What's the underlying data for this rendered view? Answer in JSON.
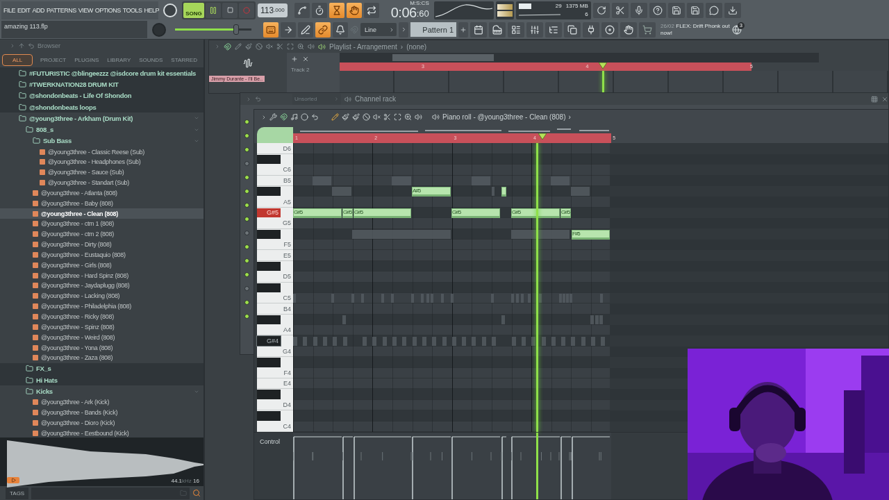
{
  "menu": [
    "FILE",
    "EDIT",
    "ADD",
    "PATTERNS",
    "VIEW",
    "OPTIONS",
    "TOOLS",
    "HELP"
  ],
  "transport": {
    "mode": {
      "label": "SONG",
      "selected": true
    },
    "playing": true,
    "tempo": "113",
    "tempo_fraction": ".000"
  },
  "toggles_top": [
    {
      "kind": "blend",
      "on": false
    },
    {
      "kind": "metronome",
      "on": false
    },
    {
      "kind": "countdown",
      "on": true
    },
    {
      "kind": "wait",
      "on": true
    },
    {
      "kind": "loop",
      "on": false
    }
  ],
  "time": {
    "main": "0:06",
    "centis": ":60",
    "unit": "M:S:CS"
  },
  "cpu": {
    "voices": "29",
    "memory": "1375 MB",
    "polyphony": "6"
  },
  "file_name": "amazing 113.flp",
  "master_volume": {
    "level": 0.8
  },
  "toggles_bottom": [
    {
      "kind": "keyboard",
      "on": true
    },
    {
      "kind": "step",
      "on": false
    },
    {
      "kind": "slide",
      "on": false
    },
    {
      "kind": "link",
      "on": true
    },
    {
      "kind": "bell",
      "on": false
    }
  ],
  "snap": "Line",
  "pattern": "Pattern 1",
  "news": {
    "date": "26/02",
    "text": "FLEX: Drift Phonk out now!",
    "badge": "3"
  },
  "browser": {
    "title": "Browser",
    "tabs": [
      {
        "label": "ALL",
        "selected": true
      },
      {
        "label": "PROJECT",
        "selected": false
      },
      {
        "label": "PLUGINS",
        "selected": false
      },
      {
        "label": "LIBRARY",
        "selected": false
      },
      {
        "label": "SOUNDS",
        "selected": false
      },
      {
        "label": "STARRED",
        "selected": false
      }
    ],
    "tree": [
      {
        "kind": "folder",
        "label": "#FUTURISTIC @blingeezzz @isdcore drum kit essentials",
        "expanded": false,
        "selected": false
      },
      {
        "kind": "folder",
        "label": "#TWERKNATION28 DRUM KIT",
        "expanded": false,
        "selected": false
      },
      {
        "kind": "folder",
        "label": "@shondonbeats - Life Of Shondon",
        "expanded": false,
        "selected": false
      },
      {
        "kind": "folder",
        "label": "@shondonbeats loops",
        "expanded": false,
        "selected": false
      },
      {
        "kind": "folder",
        "label": "@young3three - Arkham (Drum Kit)",
        "expanded": true,
        "selected": false,
        "children": [
          {
            "kind": "folder",
            "label": "808_s",
            "expanded": true,
            "selected": false,
            "children": [
              {
                "kind": "folder",
                "label": "Sub Bass",
                "expanded": true,
                "selected": false,
                "children": [
                  {
                    "kind": "file",
                    "label": "@young3three - Classic Reese (Sub)",
                    "selected": false
                  },
                  {
                    "kind": "file",
                    "label": "@young3three - Headphones (Sub)",
                    "selected": false
                  },
                  {
                    "kind": "file",
                    "label": "@young3three - Sauce (Sub)",
                    "selected": false
                  },
                  {
                    "kind": "file",
                    "label": "@young3three - Standart (Sub)",
                    "selected": false
                  }
                ]
              },
              {
                "kind": "file",
                "label": "@young3three - Atlanta (808)",
                "selected": false
              },
              {
                "kind": "file",
                "label": "@young3three - Baby (808)",
                "selected": false
              },
              {
                "kind": "file",
                "label": "@young3three - Clean (808)",
                "selected": true
              },
              {
                "kind": "file",
                "label": "@young3three - ctm 1 (808)",
                "selected": false
              },
              {
                "kind": "file",
                "label": "@young3three - ctm 2 (808)",
                "selected": false
              },
              {
                "kind": "file",
                "label": "@young3three - Dirty (808)",
                "selected": false
              },
              {
                "kind": "file",
                "label": "@young3three - Eustaquio (808)",
                "selected": false
              },
              {
                "kind": "file",
                "label": "@young3three - Girls (808)",
                "selected": false
              },
              {
                "kind": "file",
                "label": "@young3three - Hard Spinz (808)",
                "selected": false
              },
              {
                "kind": "file",
                "label": "@young3three - Jaydaplugg (808)",
                "selected": false
              },
              {
                "kind": "file",
                "label": "@young3three - Lacking (808)",
                "selected": false
              },
              {
                "kind": "file",
                "label": "@young3three - Philadelphia (808)",
                "selected": false
              },
              {
                "kind": "file",
                "label": "@young3three - Ricky (808)",
                "selected": false
              },
              {
                "kind": "file",
                "label": "@young3three - Spinz (808)",
                "selected": false
              },
              {
                "kind": "file",
                "label": "@young3three - Weird (808)",
                "selected": false
              },
              {
                "kind": "file",
                "label": "@young3three - Yona (808)",
                "selected": false
              },
              {
                "kind": "file",
                "label": "@young3three - Zaza (808)",
                "selected": false
              }
            ]
          },
          {
            "kind": "folder",
            "label": "FX_s",
            "expanded": false,
            "selected": false
          },
          {
            "kind": "folder",
            "label": "Hi Hats",
            "expanded": false,
            "selected": false
          },
          {
            "kind": "folder",
            "label": "Kicks",
            "expanded": true,
            "selected": false,
            "children": [
              {
                "kind": "file",
                "label": "@young3three - Ark (Kick)",
                "selected": false
              },
              {
                "kind": "file",
                "label": "@young3three - Bands (Kick)",
                "selected": false
              },
              {
                "kind": "file",
                "label": "@young3three - Dioro (Kick)",
                "selected": false
              },
              {
                "kind": "file",
                "label": "@young3three - Eestbound (Kick)",
                "selected": false
              }
            ]
          }
        ]
      }
    ],
    "sample_info": {
      "rate": "44.1",
      "unit": "kHz",
      "bits": "16"
    },
    "tags_button": "TAGS"
  },
  "playlist": {
    "title": "Playlist - Arrangement",
    "separator": "›",
    "target": "(none)",
    "track_clip": "Jimmy Durante - I'll Be..",
    "track_name": "Track 2",
    "ruler": [
      "3",
      "4",
      "5"
    ]
  },
  "channel_rack": {
    "filter": "Unsorted",
    "title": "Channel rack",
    "leds": [
      {
        "on": true
      },
      {
        "on": true
      },
      {
        "on": true
      },
      {
        "on": false
      },
      {
        "on": true
      },
      {
        "on": true
      },
      {
        "on": true
      },
      {
        "on": true
      },
      {
        "on": false
      },
      {
        "on": true
      },
      {
        "on": true
      },
      {
        "on": true
      },
      {
        "on": false
      },
      {
        "on": true
      },
      {
        "on": true
      }
    ]
  },
  "piano_roll": {
    "title": "Piano roll - @young3three - Clean (808)",
    "title_arrow": "›",
    "ruler": [
      "1",
      "2",
      "3",
      "4",
      "5"
    ],
    "keys": [
      {
        "label": "D6",
        "black": false,
        "playing": false,
        "highlighted": false
      },
      {
        "black": true,
        "playing": false,
        "highlighted": false
      },
      {
        "label": "C6",
        "black": false,
        "playing": false,
        "highlighted": false
      },
      {
        "label": "B5",
        "black": false,
        "playing": false,
        "highlighted": false
      },
      {
        "black": true,
        "playing": false,
        "highlighted": false
      },
      {
        "label": "A5",
        "black": false,
        "playing": false,
        "highlighted": false
      },
      {
        "label": "G#5",
        "black": true,
        "playing": true,
        "highlighted": false
      },
      {
        "label": "G5",
        "black": false,
        "playing": false,
        "highlighted": false
      },
      {
        "black": true,
        "playing": false,
        "highlighted": false
      },
      {
        "label": "F5",
        "black": false,
        "playing": false,
        "highlighted": false
      },
      {
        "label": "E5",
        "black": false,
        "playing": false,
        "highlighted": false
      },
      {
        "black": true,
        "playing": false,
        "highlighted": false
      },
      {
        "label": "D5",
        "black": false,
        "playing": false,
        "highlighted": false
      },
      {
        "black": true,
        "playing": false,
        "highlighted": false
      },
      {
        "label": "C5",
        "black": false,
        "playing": false,
        "highlighted": false
      },
      {
        "label": "B4",
        "black": false,
        "playing": false,
        "highlighted": false
      },
      {
        "black": true,
        "playing": false,
        "highlighted": false
      },
      {
        "label": "A4",
        "black": false,
        "playing": false,
        "highlighted": false
      },
      {
        "label": "G#4",
        "black": true,
        "playing": false,
        "highlighted": true
      },
      {
        "label": "G4",
        "black": false,
        "playing": false,
        "highlighted": false
      },
      {
        "black": true,
        "playing": false,
        "highlighted": false
      },
      {
        "label": "F4",
        "black": false,
        "playing": false,
        "highlighted": false
      },
      {
        "label": "E4",
        "black": false,
        "playing": false,
        "highlighted": false
      },
      {
        "black": true,
        "playing": false,
        "highlighted": false
      },
      {
        "label": "D4",
        "black": false,
        "playing": false,
        "highlighted": false
      },
      {
        "black": true,
        "playing": false,
        "highlighted": false
      },
      {
        "label": "C4",
        "black": false,
        "playing": false,
        "highlighted": false
      }
    ],
    "notes": [
      {
        "kind": "note",
        "label": "G#5"
      },
      {
        "kind": "note",
        "label": "G#5"
      },
      {
        "kind": "note",
        "label": "G#5"
      },
      {
        "kind": "note",
        "label": "A#5"
      },
      {
        "kind": "note",
        "label": "G#5"
      },
      {
        "kind": "short"
      },
      {
        "kind": "note",
        "label": "G#5"
      },
      {
        "kind": "note",
        "label": "G#5"
      },
      {
        "kind": "note",
        "label": "F#5"
      }
    ],
    "control_label": "Control"
  }
}
